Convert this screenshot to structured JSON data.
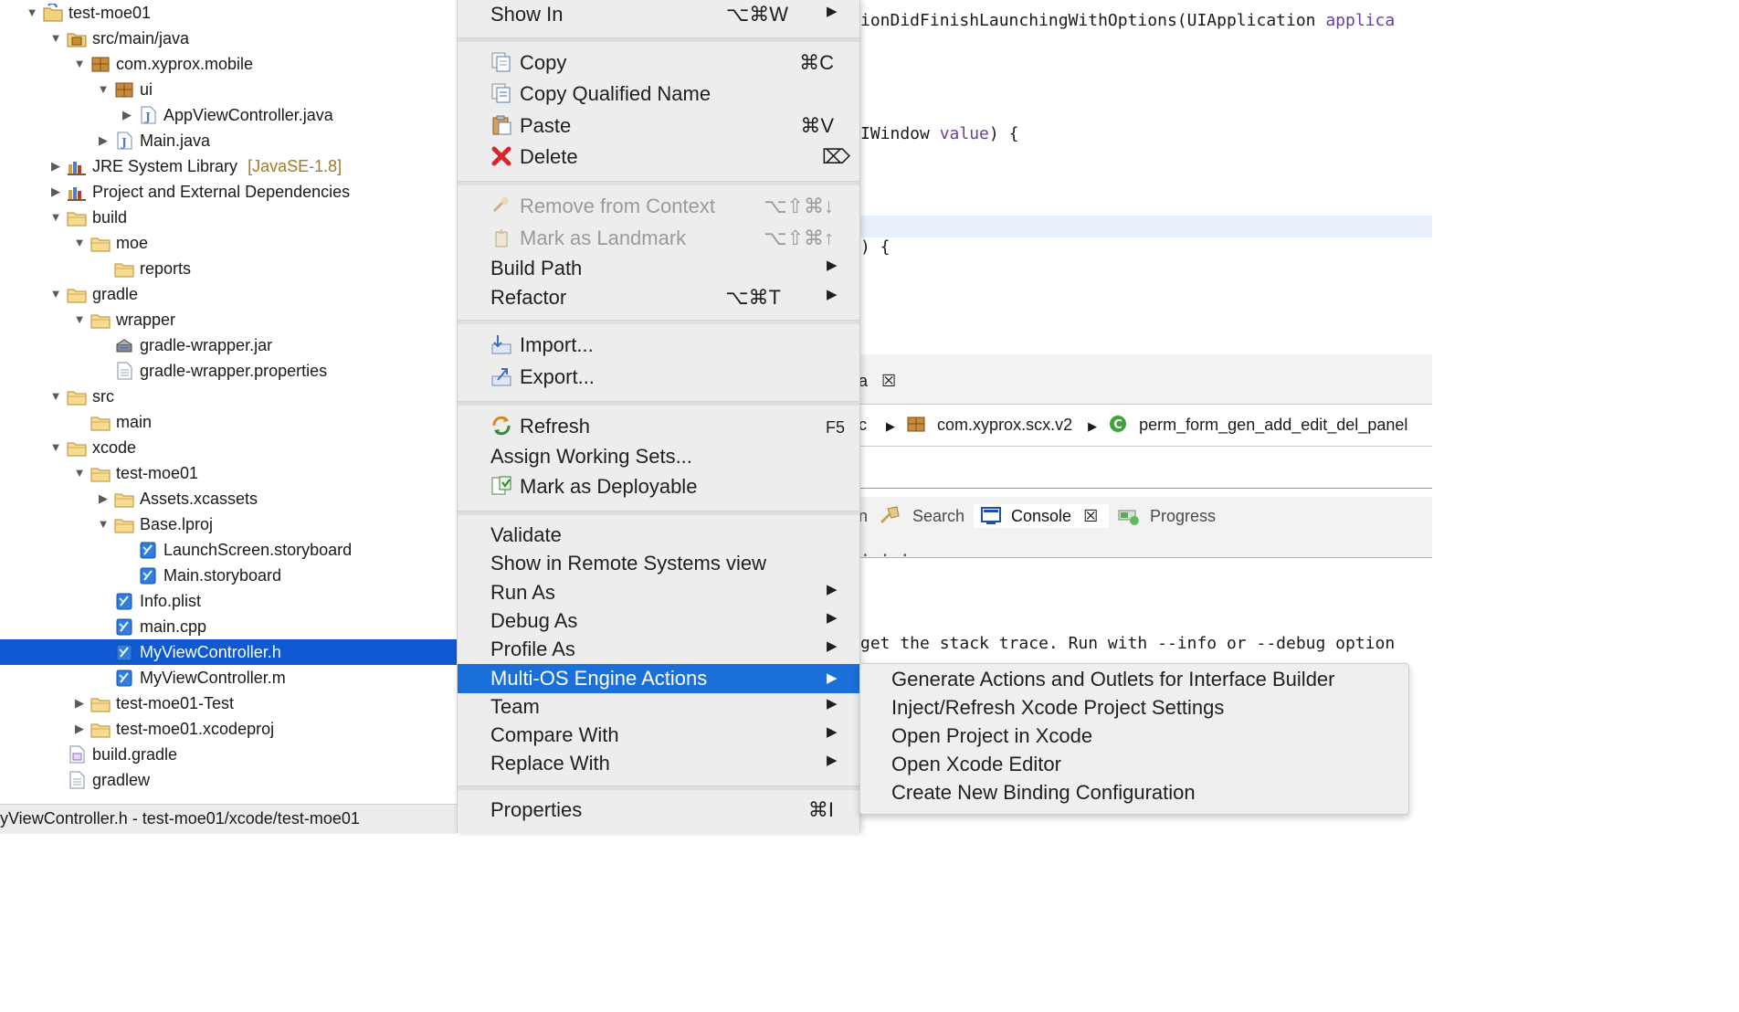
{
  "tree": {
    "items": [
      {
        "label": "test-moe01",
        "twisty": "open",
        "icon": "project"
      },
      {
        "label": "src/main/java",
        "twisty": "open",
        "icon": "source-folder"
      },
      {
        "label": "com.xyprox.mobile",
        "twisty": "open",
        "icon": "package"
      },
      {
        "label": "ui",
        "twisty": "open",
        "icon": "package"
      },
      {
        "label": "AppViewController.java",
        "twisty": "closed",
        "icon": "java-file"
      },
      {
        "label": "Main.java",
        "twisty": "closed",
        "icon": "java-file"
      },
      {
        "label": "JRE System Library",
        "decoration": "[JavaSE-1.8]",
        "twisty": "closed",
        "icon": "library"
      },
      {
        "label": "Project and External Dependencies",
        "twisty": "closed",
        "icon": "library"
      },
      {
        "label": "build",
        "twisty": "open",
        "icon": "folder"
      },
      {
        "label": "moe",
        "twisty": "open",
        "icon": "folder"
      },
      {
        "label": "reports",
        "twisty": "none",
        "icon": "folder"
      },
      {
        "label": "gradle",
        "twisty": "open",
        "icon": "folder"
      },
      {
        "label": "wrapper",
        "twisty": "open",
        "icon": "folder"
      },
      {
        "label": "gradle-wrapper.jar",
        "twisty": "none",
        "icon": "jar"
      },
      {
        "label": "gradle-wrapper.properties",
        "twisty": "none",
        "icon": "text-file"
      },
      {
        "label": "src",
        "twisty": "open",
        "icon": "folder"
      },
      {
        "label": "main",
        "twisty": "none",
        "icon": "folder"
      },
      {
        "label": "xcode",
        "twisty": "open",
        "icon": "folder"
      },
      {
        "label": "test-moe01",
        "twisty": "open",
        "icon": "folder"
      },
      {
        "label": "Assets.xcassets",
        "twisty": "closed",
        "icon": "folder"
      },
      {
        "label": "Base.lproj",
        "twisty": "open",
        "icon": "folder"
      },
      {
        "label": "LaunchScreen.storyboard",
        "twisty": "none",
        "icon": "xcode-file"
      },
      {
        "label": "Main.storyboard",
        "twisty": "none",
        "icon": "xcode-file"
      },
      {
        "label": "Info.plist",
        "twisty": "none",
        "icon": "xcode-file"
      },
      {
        "label": "main.cpp",
        "twisty": "none",
        "icon": "xcode-file"
      },
      {
        "label": "MyViewController.h",
        "twisty": "none",
        "icon": "xcode-file",
        "selected": true
      },
      {
        "label": "MyViewController.m",
        "twisty": "none",
        "icon": "xcode-file"
      },
      {
        "label": "test-moe01-Test",
        "twisty": "closed",
        "icon": "folder"
      },
      {
        "label": "test-moe01.xcodeproj",
        "twisty": "closed",
        "icon": "folder"
      },
      {
        "label": "build.gradle",
        "twisty": "none",
        "icon": "gradle-file"
      },
      {
        "label": "gradlew",
        "twisty": "none",
        "icon": "text-file"
      }
    ]
  },
  "statusbar": {
    "text": "yViewController.h - test-moe01/xcode/test-moe01"
  },
  "editor": {
    "line1": "ionDidFinishLaunchingWithOptions(UIApplication ",
    "line1_param": "applica",
    "line2": "IWindow ",
    "line2_param": "value",
    "line2_end": ") {",
    "line3": ") {",
    "tab_suffix": "a",
    "breadcrumb_prefix": "c",
    "breadcrumb_pkg": "com.xyprox.scx.v2",
    "breadcrumb_class": "perm_form_gen_add_edit_del_panel",
    "views": {
      "hidden_prefix": "n",
      "search": "Search",
      "console": "Console",
      "progress": "Progress"
    },
    "console_line": "get the stack trace. Run with --info or --debug option",
    "dots": "· · ·"
  },
  "context_menu": {
    "show_in": {
      "label": "Show In",
      "shortcut": "⌥⌘W"
    },
    "copy": {
      "label": "Copy",
      "shortcut": "⌘C"
    },
    "copy_qualified": {
      "label": "Copy Qualified Name"
    },
    "paste": {
      "label": "Paste",
      "shortcut": "⌘V"
    },
    "delete": {
      "label": "Delete",
      "shortcut": "⌦"
    },
    "remove_context": {
      "label": "Remove from Context",
      "shortcut": "⌥⇧⌘↓"
    },
    "mark_landmark": {
      "label": "Mark as Landmark",
      "shortcut": "⌥⇧⌘↑"
    },
    "build_path": {
      "label": "Build Path"
    },
    "refactor": {
      "label": "Refactor",
      "shortcut": "⌥⌘T"
    },
    "import": {
      "label": "Import..."
    },
    "export": {
      "label": "Export..."
    },
    "refresh": {
      "label": "Refresh",
      "shortcut": "F5"
    },
    "assign_sets": {
      "label": "Assign Working Sets..."
    },
    "deployable": {
      "label": "Mark as Deployable"
    },
    "validate": {
      "label": "Validate"
    },
    "remote": {
      "label": "Show in Remote Systems view"
    },
    "run_as": {
      "label": "Run As"
    },
    "debug_as": {
      "label": "Debug As"
    },
    "profile_as": {
      "label": "Profile As"
    },
    "moe": {
      "label": "Multi-OS Engine Actions"
    },
    "team": {
      "label": "Team"
    },
    "compare": {
      "label": "Compare With"
    },
    "replace": {
      "label": "Replace With"
    },
    "properties": {
      "label": "Properties",
      "shortcut": "⌘I"
    }
  },
  "submenu": {
    "items": [
      "Generate Actions and Outlets for Interface Builder",
      "Inject/Refresh Xcode Project Settings",
      "Open Project in Xcode",
      "Open Xcode Editor",
      "Create New Binding Configuration"
    ]
  },
  "colors": {
    "selection": "#0f59d2",
    "menu_highlight": "#1b6fd8",
    "folder": "#e8b84a",
    "java": "#4f7bd8"
  }
}
